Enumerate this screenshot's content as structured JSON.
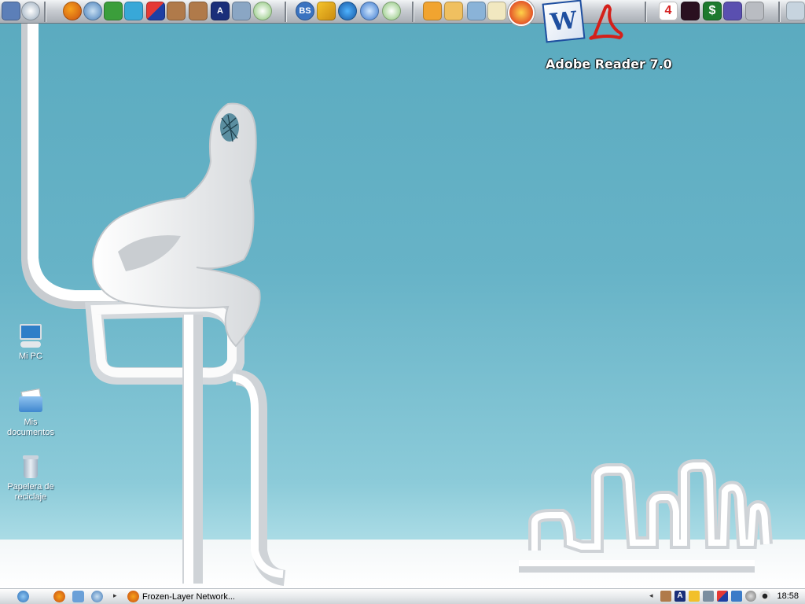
{
  "desktop": {
    "background": "#67b3c7",
    "icons": [
      {
        "label": "Mi PC",
        "icon": "my-computer-icon"
      },
      {
        "label": "Mis documentos",
        "icon": "my-documents-folder-icon"
      },
      {
        "label": "Papelera de reciclaje",
        "icon": "recycle-bin-icon"
      }
    ]
  },
  "dock": {
    "tooltip": "Adobe Reader 7.0",
    "icons": [
      "monitor-icon",
      "clock-icon",
      "firefox-icon",
      "thunderbird-icon",
      "messenger-icon",
      "msn-icon",
      "winmx-icon",
      "horse-icon",
      "horse-icon",
      "font-a-icon",
      "tools-icon",
      "music-note-icon",
      "bs-player-icon",
      "winamp-icon",
      "media-player-icon",
      "quicktime-icon",
      "itunes-icon",
      "nero-icon",
      "windows-icon",
      "photo-icon",
      "checklist-icon",
      "nero-burn-icon",
      "word-icon",
      "acrobat-icon",
      "pes4-icon",
      "skull-icon",
      "money-icon",
      "gameboy-icon",
      "snes-icon",
      "recycle-icon"
    ],
    "word_letter": "W",
    "bs_label": "BS",
    "font_label": "A",
    "pes_label": "4",
    "money_label": "$"
  },
  "taskbar": {
    "task_label": "Frozen-Layer Network...",
    "clock": "18:58",
    "tray_font_label": "A"
  }
}
